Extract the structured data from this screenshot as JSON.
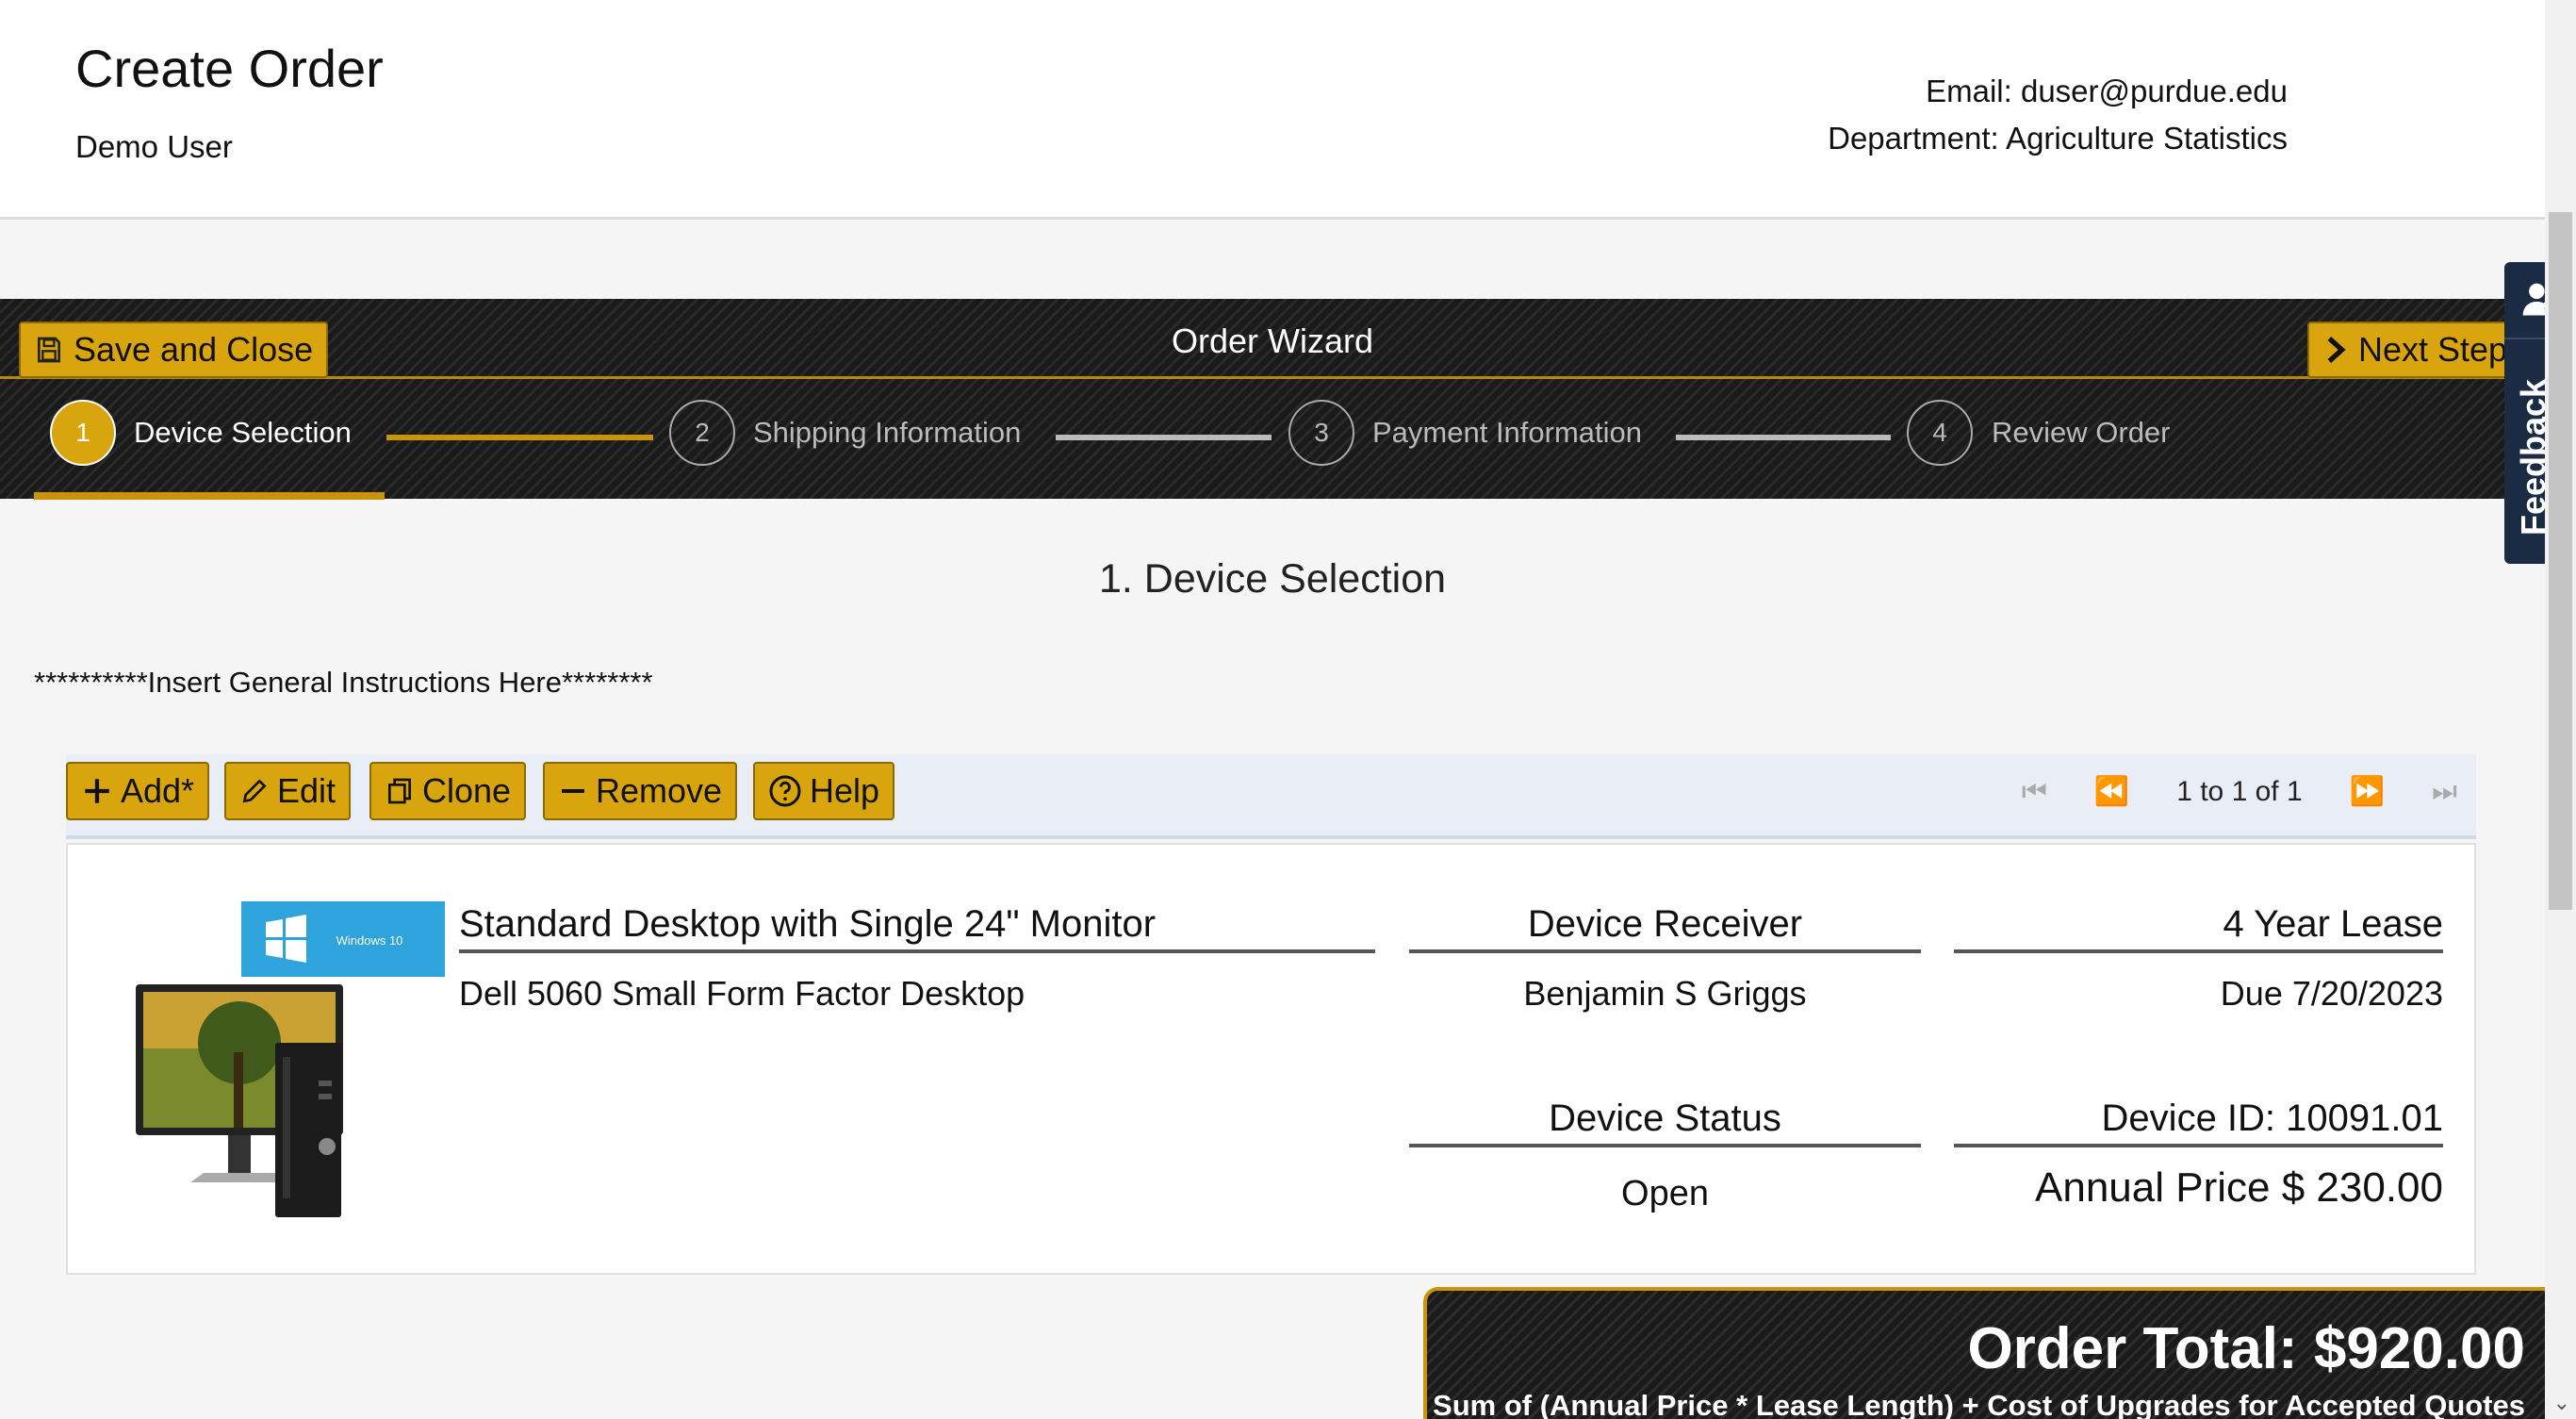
{
  "header": {
    "title": "Create Order",
    "user_name": "Demo User",
    "email": "Email: duser@purdue.edu",
    "department": "Department: Agriculture Statistics"
  },
  "wizard": {
    "title": "Order Wizard",
    "save_label": "Save and Close",
    "next_label": "Next Step",
    "steps": [
      {
        "number": "1",
        "label": "Device Selection"
      },
      {
        "number": "2",
        "label": "Shipping Information"
      },
      {
        "number": "3",
        "label": "Payment Information"
      },
      {
        "number": "4",
        "label": "Review Order"
      }
    ],
    "active_step": 1
  },
  "main": {
    "heading": "1. Device Selection",
    "instructions": "**********Insert General Instructions Here********"
  },
  "toolbar": {
    "add_label": "Add*",
    "edit_label": "Edit",
    "clone_label": "Clone",
    "remove_label": "Remove",
    "help_label": "Help",
    "pager_text": "1 to 1 of 1"
  },
  "device": {
    "os_badge": "Windows 10",
    "name": "Standard Desktop with Single 24\" Monitor",
    "model": "Dell 5060 Small Form Factor Desktop",
    "receiver_label": "Device Receiver",
    "receiver": "Benjamin S Griggs",
    "status_label": "Device Status",
    "status": "Open",
    "lease": "4 Year Lease",
    "due": "Due 7/20/2023",
    "device_id": "Device ID: 10091.01",
    "annual_price": "Annual Price $ 230.00"
  },
  "totals": {
    "order_total": "Order Total: $920.00",
    "formula": "Sum of (Annual Price * Lease Length) + Cost of Upgrades for Accepted Quotes"
  },
  "feedback": {
    "label": "Feedback"
  },
  "colors": {
    "accent_gold": "#d9a50f",
    "dark_band": "#1a1a1a",
    "feedback_navy": "#1c2b44",
    "os_badge_blue": "#2ea3dc"
  }
}
